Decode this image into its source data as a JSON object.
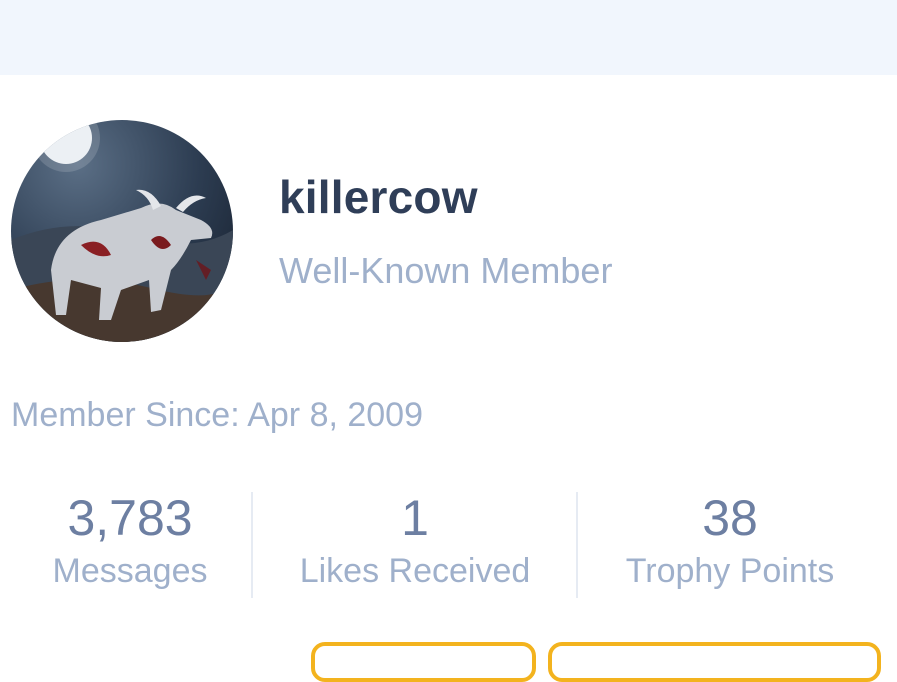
{
  "profile": {
    "username": "killercow",
    "user_title": "Well-Known Member",
    "member_since": "Member Since: Apr 8, 2009"
  },
  "stats": [
    {
      "value": "3,783",
      "label": "Messages"
    },
    {
      "value": "1",
      "label": "Likes Received"
    },
    {
      "value": "38",
      "label": "Trophy Points"
    }
  ],
  "colors": {
    "top_band": "#f1f6fd",
    "username": "#2f3e58",
    "muted_text": "#9fb0cb",
    "stat_number": "#6d7fa2",
    "button_border": "#f3b31e"
  }
}
